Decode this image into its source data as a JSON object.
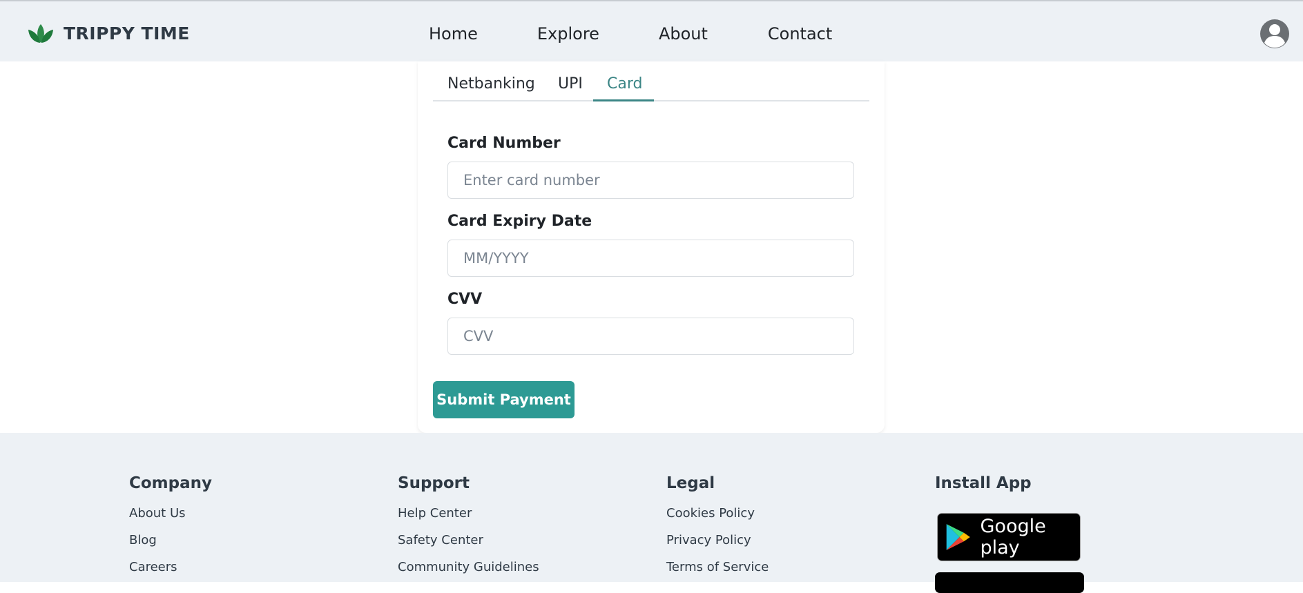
{
  "brand": {
    "name": "TRIPPY TIME"
  },
  "nav": {
    "links": [
      "Home",
      "Explore",
      "About",
      "Contact"
    ]
  },
  "tabs": [
    {
      "label": "Netbanking"
    },
    {
      "label": "UPI"
    },
    {
      "label": "Card",
      "active": true
    }
  ],
  "form": {
    "card_number": {
      "label": "Card Number",
      "placeholder": "Enter card number"
    },
    "expiry": {
      "label": "Card Expiry Date",
      "placeholder": "MM/YYYY"
    },
    "cvv": {
      "label": "CVV",
      "placeholder": "CVV"
    },
    "submit_label": "Submit Payment"
  },
  "footer": {
    "company": {
      "title": "Company",
      "items": [
        "About Us",
        "Blog",
        "Careers"
      ]
    },
    "support": {
      "title": "Support",
      "items": [
        "Help Center",
        "Safety Center",
        "Community Guidelines"
      ]
    },
    "legal": {
      "title": "Legal",
      "items": [
        "Cookies Policy",
        "Privacy Policy",
        "Terms of Service"
      ]
    },
    "install": {
      "title": "Install App",
      "google_play_label": "Google play"
    }
  },
  "colors": {
    "accent": "#2d9a94",
    "tab_active": "#3b8585",
    "nav_bg": "#edf1f5"
  }
}
